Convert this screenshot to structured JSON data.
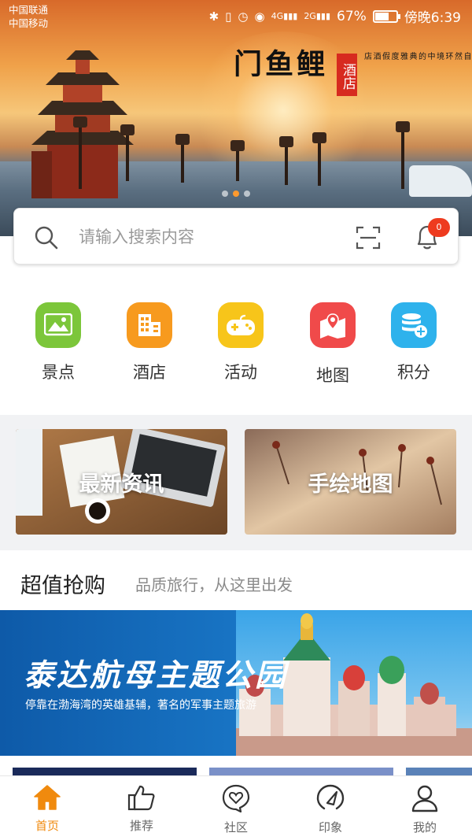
{
  "status_bar": {
    "carriers": [
      "中国联通",
      "中国移动"
    ],
    "network_primary": "4G",
    "network_secondary": "2G",
    "battery_percent": "67%",
    "battery_level": 0.67,
    "time": "傍晚6:39"
  },
  "banner": {
    "brand_name": "鲤鱼门",
    "brand_seal": "酒店",
    "slogan": "自然环境中的典雅度假酒店",
    "slide_count": 3,
    "active_slide": 2
  },
  "search": {
    "placeholder": "请输入搜索内容",
    "notification_count": "0"
  },
  "categories": [
    {
      "label": "景点",
      "icon": "scenery-icon",
      "color": "#7cc63a"
    },
    {
      "label": "酒店",
      "icon": "hotel-icon",
      "color": "#f79a1e"
    },
    {
      "label": "活动",
      "icon": "gamepad-icon",
      "color": "#f7c51a"
    },
    {
      "label": "地图",
      "icon": "map-icon",
      "color": "#f04a4a"
    },
    {
      "label": "积分",
      "icon": "points-database-icon",
      "color": "#2eb2ec"
    }
  ],
  "promos": [
    {
      "title": "最新资讯"
    },
    {
      "title": "手绘地图"
    }
  ],
  "deals": {
    "title": "超值抢购",
    "subtitle": "品质旅行，从这里出发",
    "feature": {
      "title": "泰达航母主题公园",
      "description": "停靠在渤海湾的英雄基辅，著名的军事主题旅游"
    }
  },
  "tabs": [
    {
      "label": "首页",
      "icon": "home-icon",
      "active": true
    },
    {
      "label": "推荐",
      "icon": "thumbs-up-icon",
      "active": false
    },
    {
      "label": "社区",
      "icon": "community-heart-icon",
      "active": false
    },
    {
      "label": "印象",
      "icon": "compass-gauge-icon",
      "active": false
    },
    {
      "label": "我的",
      "icon": "user-icon",
      "active": false
    }
  ],
  "colors": {
    "accent": "#f08a0e",
    "badge": "#ee3b1f"
  }
}
